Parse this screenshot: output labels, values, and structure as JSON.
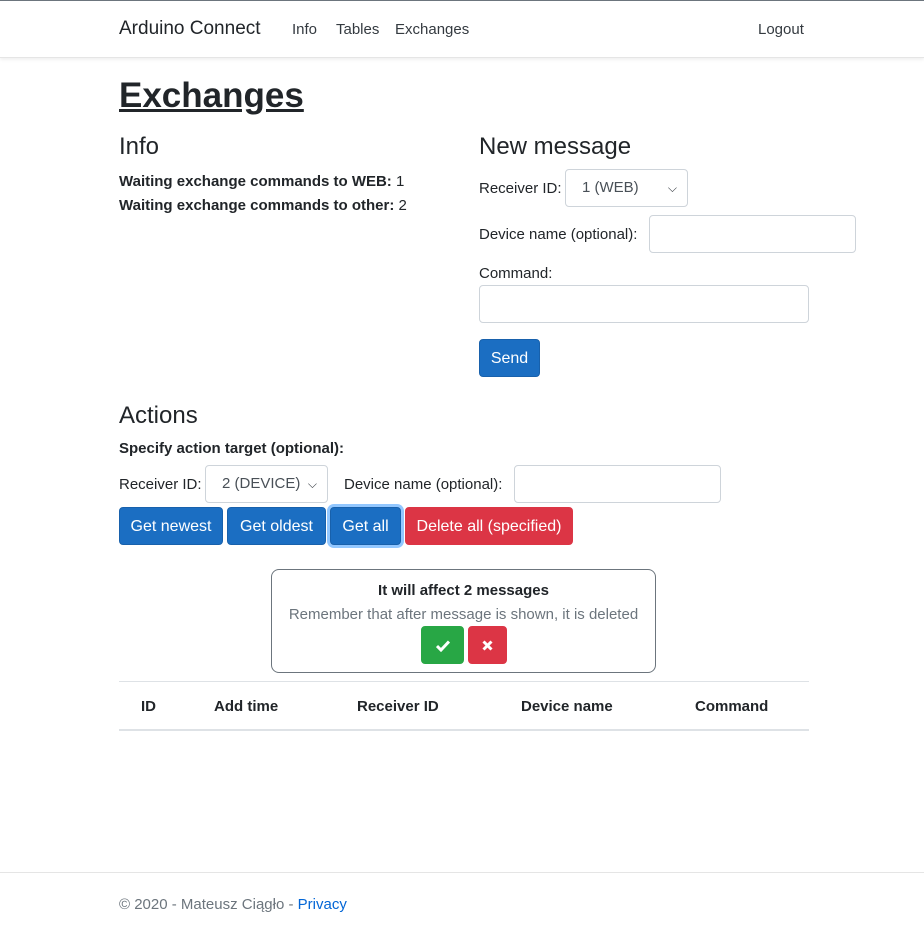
{
  "nav": {
    "brand": "Arduino Connect",
    "links": [
      "Info",
      "Tables",
      "Exchanges"
    ],
    "logout": "Logout"
  },
  "page": {
    "title": "Exchanges"
  },
  "info": {
    "title": "Info",
    "web_label": "Waiting exchange commands to WEB:",
    "web_value": "1",
    "other_label": "Waiting exchange commands to other:",
    "other_value": "2"
  },
  "new_message": {
    "title": "New message",
    "receiver_label": "Receiver ID:",
    "receiver_value": "1 (WEB)",
    "device_label": "Device name (optional):",
    "device_value": "",
    "command_label": "Command:",
    "command_value": "",
    "send_label": "Send"
  },
  "actions": {
    "title": "Actions",
    "target_label": "Specify action target (optional):",
    "receiver_label": "Receiver ID:",
    "receiver_value": "2 (DEVICE)",
    "device_label": "Device name (optional):",
    "device_value": "",
    "buttons": {
      "get_newest": "Get newest",
      "get_oldest": "Get oldest",
      "get_all": "Get all",
      "delete_all": "Delete all (specified)"
    }
  },
  "confirm": {
    "title": "It will affect 2 messages",
    "subtitle": "Remember that after message is shown, it is deleted",
    "confirm_icon": "check-icon",
    "cancel_icon": "close-icon"
  },
  "table": {
    "columns": [
      "ID",
      "Add time",
      "Receiver ID",
      "Device name",
      "Command"
    ],
    "rows": []
  },
  "footer": {
    "text": "© 2020 - Mateusz Ciągło - ",
    "link": "Privacy"
  },
  "colors": {
    "primary": "#1b6ec2",
    "danger": "#dc3545",
    "success": "#28a745",
    "link": "#0366d6"
  }
}
